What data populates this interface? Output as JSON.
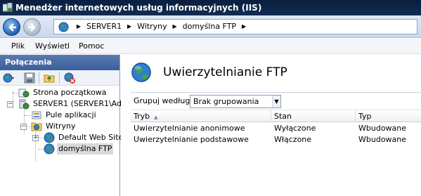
{
  "window": {
    "title": "Menedżer internetowych usług informacyjnych (IIS)"
  },
  "address": {
    "crumbs": [
      "SERVER1",
      "Witryny",
      "domyślna FTP"
    ]
  },
  "menu": {
    "items": [
      "Plik",
      "Wyświetl",
      "Pomoc"
    ]
  },
  "connections": {
    "title": "Połączenia",
    "toolbar_icons": [
      "connect-icon",
      "save-icon",
      "up-folder-icon",
      "disconnect-icon"
    ],
    "tree": [
      {
        "label": "Strona początkowa",
        "icon": "start-page-icon"
      },
      {
        "label": "SERVER1 (SERVER1\\Adm",
        "icon": "server-icon"
      },
      {
        "label": "Pule aplikacji",
        "icon": "app-pools-icon"
      },
      {
        "label": "Witryny",
        "icon": "sites-folder-icon"
      },
      {
        "label": "Default Web Site",
        "icon": "globe-icon"
      },
      {
        "label": "domyślna FTP",
        "icon": "globe-icon",
        "selected": true
      }
    ]
  },
  "main": {
    "title": "Uwierzytelnianie FTP",
    "group_by_label": "Grupuj według:",
    "group_by_value": "Brak grupowania",
    "columns": [
      "Tryb",
      "Stan",
      "Typ"
    ],
    "rows": [
      {
        "mode": "Uwierzytelnianie anonimowe",
        "state": "Wyłączone",
        "type": "Wbudowane"
      },
      {
        "mode": "Uwierzytelnianie podstawowe",
        "state": "Włączone",
        "type": "Wbudowane"
      }
    ]
  },
  "colors": {
    "title_bar": "#0a1f3f",
    "panel_header": "#3b5f9c",
    "selection": "#d9d9d9"
  }
}
